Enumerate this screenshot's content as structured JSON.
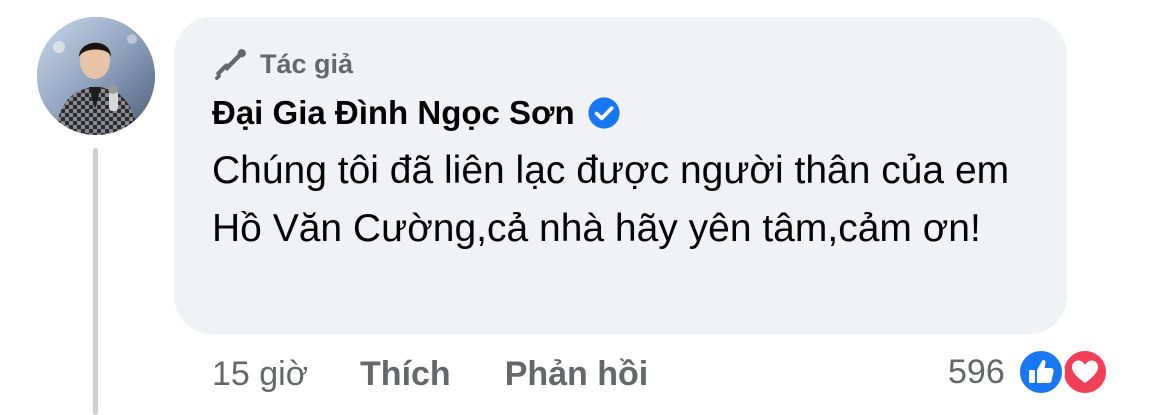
{
  "comment": {
    "author_badge": {
      "label": "Tác giả",
      "icon": "megaphone-icon"
    },
    "author_name": "Đại Gia Đình Ngọc Sơn",
    "verified_icon": "verified-badge-icon",
    "text": "Chúng tôi đã liên lạc được người thân của em Hồ Văn Cường,cả nhà hãy yên tâm,cảm ơn!",
    "bubble_color": "#f0f2f5"
  },
  "actions": {
    "time": "15 giờ",
    "like_label": "Thích",
    "reply_label": "Phản hồi"
  },
  "reactions": {
    "count": "596",
    "types": [
      "like",
      "love"
    ],
    "like_color": "#1877f2",
    "love_color": "#f33e58"
  }
}
